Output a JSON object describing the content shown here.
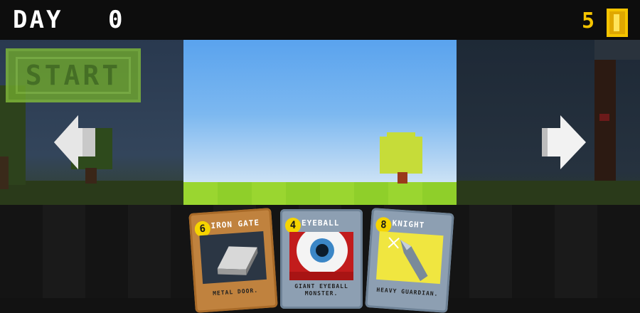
{
  "hud": {
    "day_label": "DAY",
    "day_number": "0",
    "coins": "5",
    "coin_icon": "coin-icon"
  },
  "start_button": {
    "label": "START"
  },
  "navigation": {
    "prev_icon": "arrow-left-icon",
    "next_icon": "arrow-right-icon"
  },
  "cards": [
    {
      "cost": "6",
      "name": "IRON GATE",
      "desc": "METAL DOOR.",
      "art_icon": "iron-block-icon"
    },
    {
      "cost": "4",
      "name": "EYEBALL",
      "desc": "GIANT EYEBALL MONSTER.",
      "art_icon": "eyeball-icon"
    },
    {
      "cost": "8",
      "name": "KNIGHT",
      "desc": "HEAVY GUARDIAN.",
      "art_icon": "sword-icon"
    }
  ],
  "colors": {
    "coin": "#f5c400",
    "sky_top": "#5aa3ee",
    "grass": "#8fcf2a",
    "tree": "#c6dc39",
    "start_button": "#6fa62e",
    "card_bronze": "#c0823e",
    "card_steel": "#8d9fb2"
  }
}
